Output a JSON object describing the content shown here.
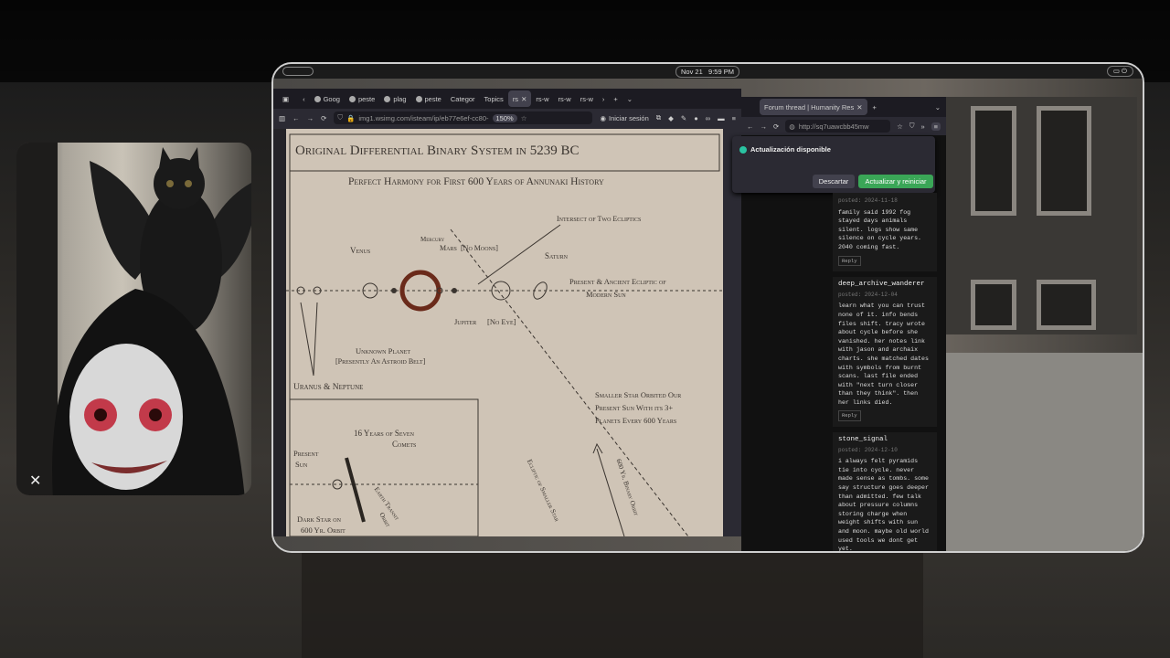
{
  "topbar": {
    "date": "Nov 21",
    "time": "9:59 PM"
  },
  "browser_left": {
    "tabs": [
      {
        "label": "Goog"
      },
      {
        "label": "peste"
      },
      {
        "label": "plag"
      },
      {
        "label": "peste"
      },
      {
        "label": "Categor"
      },
      {
        "label": "Topics"
      },
      {
        "label": "rs"
      },
      {
        "label": "rs-w"
      },
      {
        "label": "rs-w"
      },
      {
        "label": "rs-w"
      }
    ],
    "url": "img1.wsimg.com/isteam/ip/eb77e6ef-cc80-",
    "zoom": "150%",
    "login_label": "Iniciar sesión"
  },
  "diagram": {
    "title": "Original Differential Binary System in 5239 BC",
    "subtitle": "Perfect Harmony for First 600 Years of Annunaki History",
    "labels": {
      "venus": "Venus",
      "mercury": "Mercury",
      "mars": "Mars",
      "mars_note": "[No Moons]",
      "intersect": "Intersect of Two Ecliptics",
      "saturn": "Saturn",
      "ecliptic": "Present & Ancient Ecliptic of",
      "ecliptic2": "Modern Sun",
      "jupiter": "Jupiter",
      "jupiter_note": "[No Eye]",
      "unknown_planet": "Unknown Planet",
      "unknown_planet_note": "[Presently An Astroid Belt]",
      "uranus_neptune": "Uranus & Neptune",
      "smaller_star_1": "Smaller Star Orbited Our",
      "smaller_star_2": "Present Sun With its 3+",
      "smaller_star_3": "Planets Every 600 Years",
      "ecliptic_smaller": "Ecliptic of Smaller Star",
      "binary_orbit": "600 Yr. Binary Orbit",
      "seven_comets_1": "16 Years of Seven",
      "seven_comets_2": "Comets",
      "present_sun_1": "Present",
      "present_sun_2": "Sun",
      "dark_star_1": "Dark Star on",
      "dark_star_2": "600 Yr. Orbit",
      "earth_transit": "Earth Transit",
      "orbit": "Orbit"
    }
  },
  "browser_right": {
    "tab_title": "Forum thread | Humanity Res",
    "url": "http://sq7uawcbb45mw",
    "popup": {
      "title": "Actualización disponible",
      "dismiss": "Descartar",
      "update": "Actualizar y reiniciar"
    },
    "posts": [
      {
        "user": "",
        "date": "posted: 2024-11-18",
        "text": "family said 1992 fog stayed days animals silent. logs show same silence on cycle years. 2040 coming fast.",
        "reply": "Reply"
      },
      {
        "user": "deep_archive_wanderer",
        "date": "posted: 2024-12-04",
        "text": "learn what you can trust none of it. info bends files shift. tracy wrote about cycle before she vanished. her notes link with jason and archaix charts. she matched dates with symbols from burnt scans. last file ended with \"next turn closer than they think\". then her links died.",
        "reply": "Reply"
      },
      {
        "user": "stone_signal",
        "date": "posted: 2024-12-10",
        "text": "i always felt pyramids tie into cycle. never made sense as tombs. some say structure goes deeper than admitted. few talk about pressure columns storing charge when weight shifts with sun and moon. maybe old world used tools we dont get yet.",
        "reply": ""
      }
    ]
  },
  "colors": {
    "accent_green": "#3aa657",
    "paper": "#cfc4b6",
    "ink": "#3a342f"
  }
}
